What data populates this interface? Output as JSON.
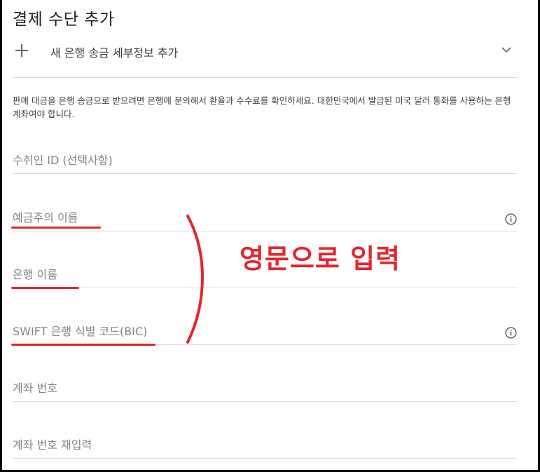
{
  "page": {
    "title": "결제 수단 추가"
  },
  "add_bank": {
    "label": "새 은행 송금 세부정보 추가"
  },
  "description": "판매 대금을 은행 송금으로 받으려면 은행에 문의해서 환율과 수수료를 확인하세요. 대한민국에서 발급된 미국 달러 통화를 사용하는 은행 계좌여야 합니다.",
  "fields": {
    "recipient_id": "수취인 ID (선택사항)",
    "account_holder": "예금주의 이름",
    "bank_name": "은행 이름",
    "swift": "SWIFT 은행 식별 코드(BIC)",
    "account_number": "계좌 번호",
    "account_number_confirm": "계좌 번호 재입력"
  },
  "annotation": {
    "text": "영문으로 입력",
    "color": "#e3262e"
  },
  "icons": [
    "plus-icon",
    "chevron-down-icon",
    "info-icon"
  ]
}
